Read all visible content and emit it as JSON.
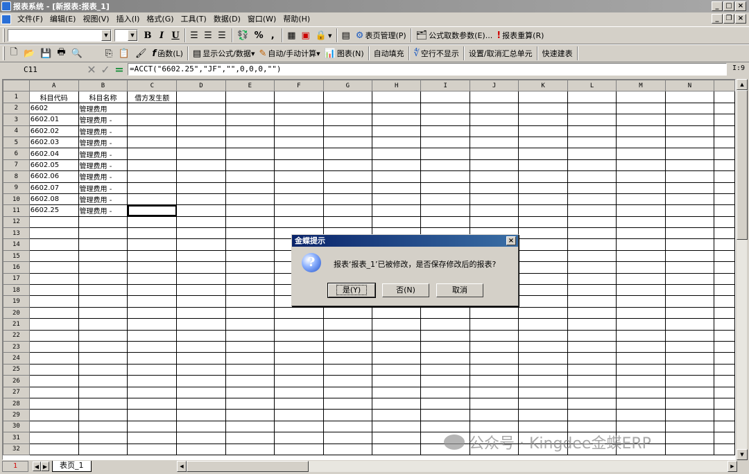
{
  "window": {
    "title": "报表系统 - [新报表:报表_1]"
  },
  "menu": [
    "文件(F)",
    "编辑(E)",
    "视图(V)",
    "插入(I)",
    "格式(G)",
    "工具(T)",
    "数据(D)",
    "窗口(W)",
    "帮助(H)"
  ],
  "toolbar1": {
    "bold": "B",
    "italic": "I",
    "underline": "U",
    "percent": "%",
    "comma": ",",
    "page_mgmt": "表页管理(P)",
    "formula_params": "公式取数参数(E)...",
    "recalc": "报表重算(R)"
  },
  "toolbar2": {
    "func": "函数(L)",
    "show_formula": "显示公式/数据",
    "auto_calc": "自动/手动计算",
    "chart": "图表(N)",
    "auto_fill": "自动填充",
    "hide_empty": "空行不显示",
    "set_summary": "设置/取消汇总单元",
    "quick_build": "快速建表"
  },
  "formula_bar": {
    "cell_ref": "C11",
    "formula": "=ACCT(\"6602.25\",\"JF\",\"\",0,0,0,\"\")",
    "zoom": "I:9"
  },
  "grid": {
    "columns": [
      "A",
      "B",
      "C",
      "D",
      "E",
      "F",
      "G",
      "H",
      "I",
      "J",
      "K",
      "L",
      "M",
      "N"
    ],
    "rows": [
      [
        "科目代码",
        "科目名称",
        "借方发生额"
      ],
      [
        "6602",
        "管理费用",
        ""
      ],
      [
        "6602.01",
        "管理费用 -",
        ""
      ],
      [
        "6602.02",
        "管理费用 -",
        ""
      ],
      [
        "6602.03",
        "管理费用 -",
        ""
      ],
      [
        "6602.04",
        "管理费用 -",
        ""
      ],
      [
        "6602.05",
        "管理费用 -",
        ""
      ],
      [
        "6602.06",
        "管理费用 -",
        ""
      ],
      [
        "6602.07",
        "管理费用 -",
        ""
      ],
      [
        "6602.08",
        "管理费用 -",
        ""
      ],
      [
        "6602.25",
        "管理费用 -",
        ""
      ]
    ],
    "row_count": 32,
    "selected_row": "1"
  },
  "sheet_tab": "表页_1",
  "dialog": {
    "title": "金蝶提示",
    "message": "报表‘报表_1’已被修改，是否保存修改后的报表?",
    "yes": "是(Y)",
    "no": "否(N)",
    "cancel": "取消"
  },
  "watermark": "公众号 · Kingdee金蝶ERP"
}
